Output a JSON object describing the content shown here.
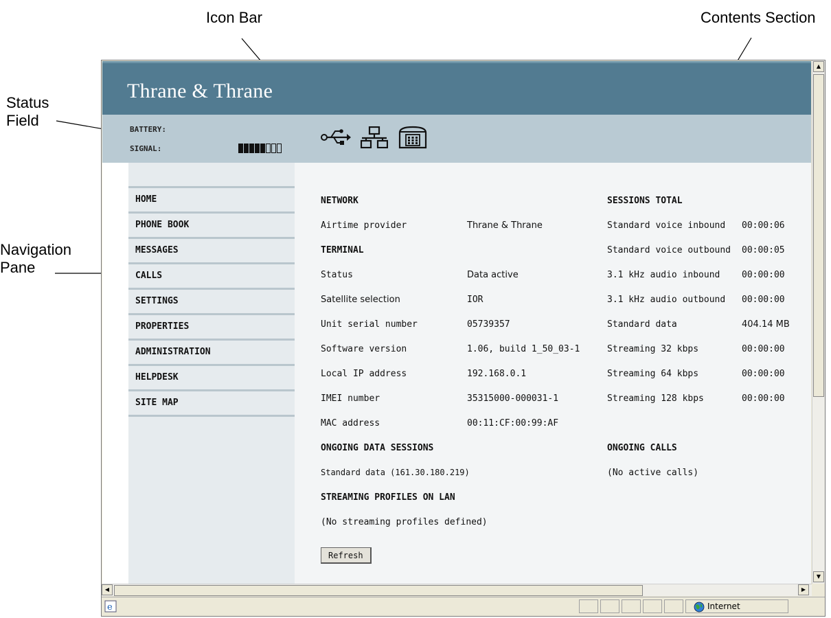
{
  "callouts": {
    "icon_bar": "Icon Bar",
    "contents_section": "Contents Section",
    "status_field_line1": "Status",
    "status_field_line2": "Field",
    "navigation_pane_line1": "Navigation",
    "navigation_pane_line2": "Pane"
  },
  "header": {
    "brand": "Thrane & Thrane"
  },
  "status": {
    "battery_label": "BATTERY:",
    "signal_label": "SIGNAL:",
    "signal_bars_filled": 5,
    "signal_bars_total": 8
  },
  "icons": [
    "usb-icon",
    "lan-icon",
    "phone-icon"
  ],
  "nav": {
    "items": [
      {
        "label": "HOME"
      },
      {
        "label": "PHONE BOOK"
      },
      {
        "label": "MESSAGES"
      },
      {
        "label": "CALLS"
      },
      {
        "label": "SETTINGS"
      },
      {
        "label": "PROPERTIES"
      },
      {
        "label": "ADMINISTRATION"
      },
      {
        "label": "HELPDESK"
      },
      {
        "label": "SITE MAP"
      }
    ]
  },
  "network": {
    "heading": "NETWORK",
    "airtime_label": "Airtime provider",
    "airtime_value": "Thrane & Thrane"
  },
  "terminal": {
    "heading": "TERMINAL",
    "rows": [
      {
        "label": "Status",
        "value": "Data active"
      },
      {
        "label": "Satellite selection",
        "value": "IOR"
      },
      {
        "label": "Unit serial number",
        "value": "05739357"
      },
      {
        "label": "Software version",
        "value": "1.06, build 1_50_03-1"
      },
      {
        "label": "Local IP address",
        "value": "192.168.0.1"
      },
      {
        "label": "IMEI number",
        "value": "35315000-000031-1"
      },
      {
        "label": "MAC address",
        "value": "00:11:CF:00:99:AF"
      }
    ]
  },
  "sessions_total": {
    "heading": "SESSIONS TOTAL",
    "rows": [
      {
        "label": "Standard voice inbound",
        "value": "00:00:06"
      },
      {
        "label": "Standard voice outbound",
        "value": "00:00:05"
      },
      {
        "label": "3.1 kHz audio inbound",
        "value": "00:00:00"
      },
      {
        "label": "3.1 kHz audio outbound",
        "value": "00:00:00"
      },
      {
        "label": "Standard data",
        "value": "404.14 MB"
      },
      {
        "label": "Streaming 32 kbps",
        "value": "00:00:00"
      },
      {
        "label": "Streaming 64 kbps",
        "value": "00:00:00"
      },
      {
        "label": "Streaming 128 kbps",
        "value": "00:00:00"
      }
    ]
  },
  "ongoing_data": {
    "heading": "ONGOING DATA SESSIONS",
    "text": "Standard data (161.30.180.219)"
  },
  "ongoing_calls": {
    "heading": "ONGOING CALLS",
    "text": "(No active calls)"
  },
  "streaming": {
    "heading": "STREAMING PROFILES ON LAN",
    "text": "(No streaming profiles defined)"
  },
  "refresh_label": "Refresh",
  "ie_status": {
    "zone": "Internet"
  },
  "colors": {
    "header_bg": "#527b91",
    "status_bg": "#b9cad3",
    "nav_bg": "#e6ebee",
    "content_bg": "#f3f5f6"
  }
}
